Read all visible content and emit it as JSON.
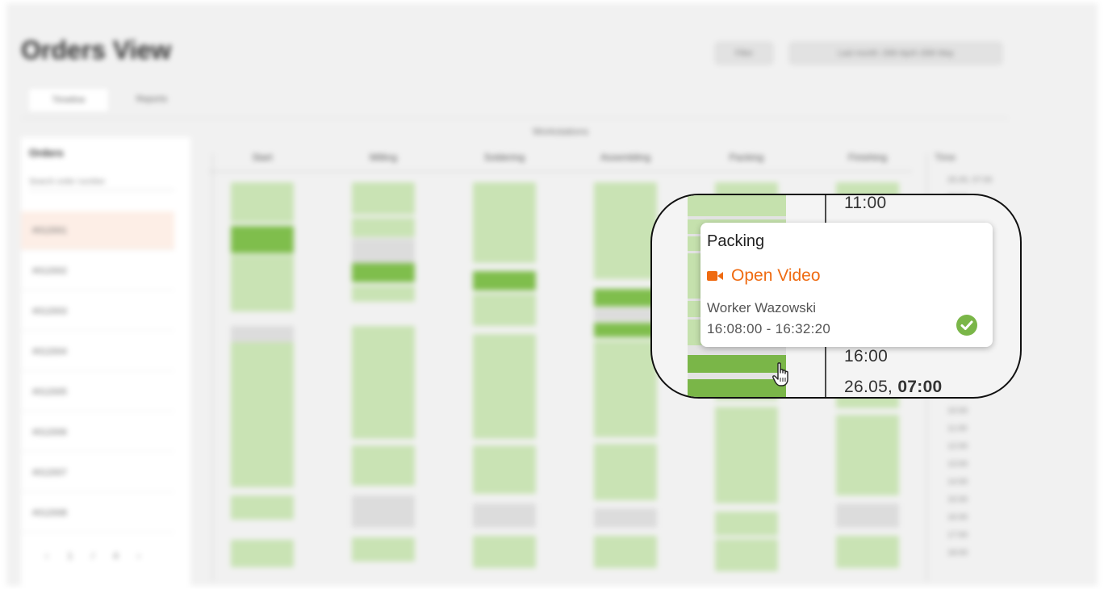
{
  "header": {
    "title": "Orders View",
    "filter_label": "Filter",
    "date_range": "Last month: 26th April–26th May"
  },
  "tabs": [
    "Timeline",
    "Reports"
  ],
  "orders": {
    "title": "Orders",
    "search_placeholder": "Search order number",
    "items": [
      "#012001",
      "#012002",
      "#012003",
      "#012004",
      "#012005",
      "#012006",
      "#012007",
      "#012008"
    ],
    "pager": "‹ 1 / 4 ›"
  },
  "timeline": {
    "group_label": "Workstations",
    "columns": [
      "Start",
      "Milling",
      "Soldering",
      "Assembling",
      "Packing",
      "Finishing"
    ],
    "time_header": "Time",
    "ticks": [
      "25.05, 07:00",
      "08:00",
      "09:00",
      "10:00",
      "11:00",
      "12:00",
      "13:00",
      "14:00",
      "15:00",
      "16:00",
      "26.05, 07:00",
      "08:00",
      "09:00",
      "10:00",
      "11:00",
      "12:00",
      "13:00",
      "14:00",
      "15:00",
      "16:00",
      "17:00",
      "18:00"
    ]
  },
  "zoom": {
    "times": [
      "11:00",
      "16:00"
    ],
    "date_time": {
      "date": "26.05,",
      "time": "07:00"
    }
  },
  "tooltip": {
    "title": "Packing",
    "link_label": "Open Video",
    "worker": "Worker Wazowski",
    "time_range": "16:08:00 - 16:32:20",
    "status": "completed"
  },
  "colors": {
    "accent": "#ef6b12",
    "bar_light": "#c5e1ad",
    "bar_dark": "#7ab648",
    "check": "#7ab648"
  }
}
